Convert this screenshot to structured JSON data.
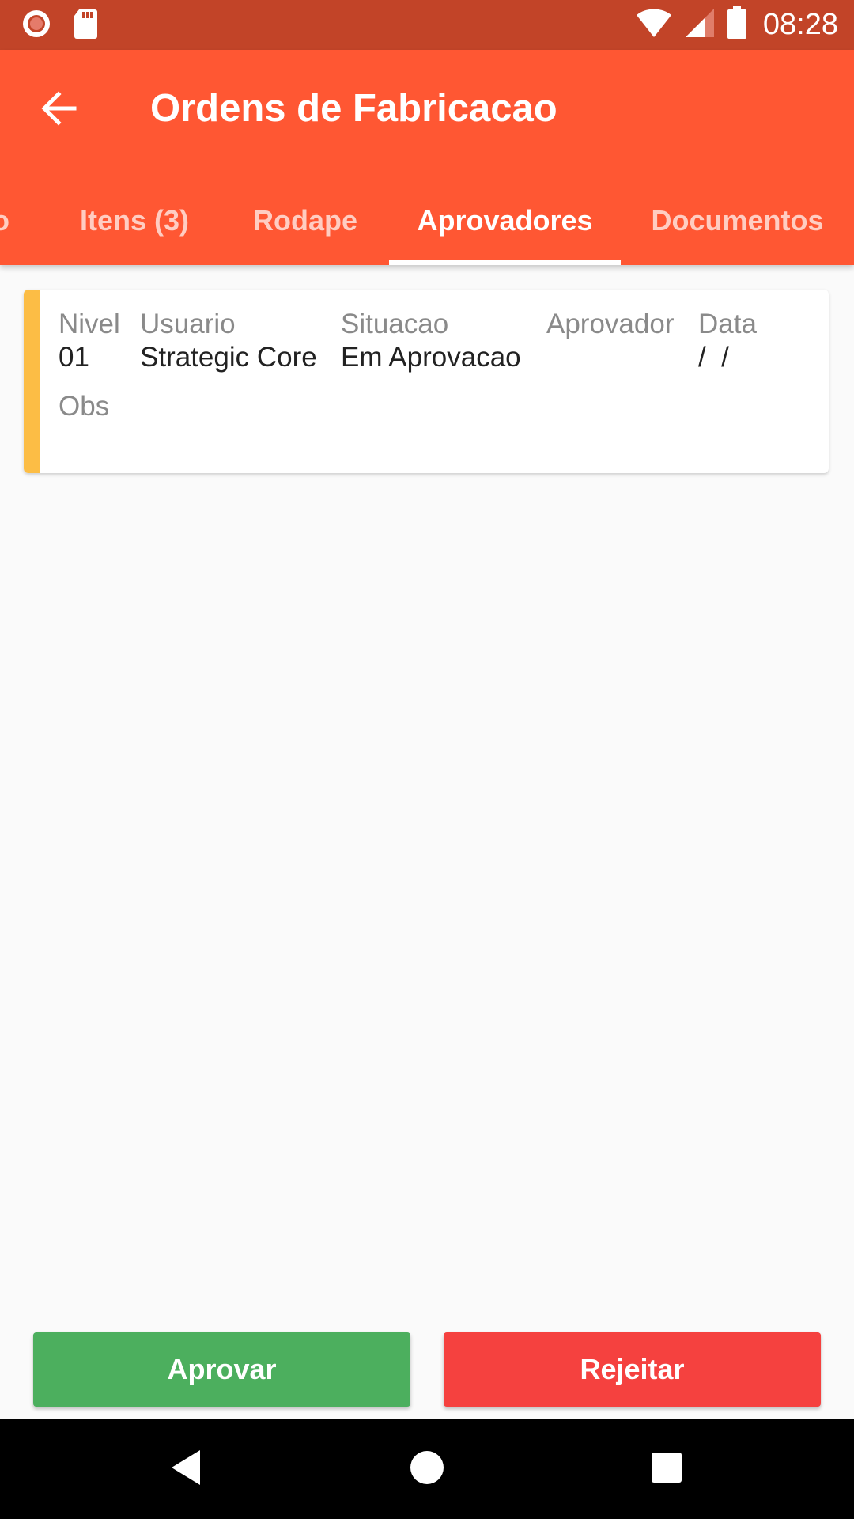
{
  "status_bar": {
    "time": "08:28",
    "icons": [
      "record-icon",
      "sd-card-icon",
      "wifi-icon",
      "signal-icon",
      "battery-icon"
    ]
  },
  "app_bar": {
    "title": "Ordens de Fabricacao",
    "back_icon": "arrow-left-icon"
  },
  "tabs": [
    {
      "label": "o",
      "active": false
    },
    {
      "label": "Itens (3)",
      "active": false
    },
    {
      "label": "Rodape",
      "active": false
    },
    {
      "label": "Aprovadores",
      "active": true
    },
    {
      "label": "Documentos",
      "active": false
    }
  ],
  "approver_card": {
    "nivel_label": "Nivel",
    "nivel_value": "01",
    "usuario_label": "Usuario",
    "usuario_value": "Strategic Core",
    "situacao_label": "Situacao",
    "situacao_value": "Em Aprovacao",
    "aprovador_label": "Aprovador",
    "aprovador_value": "",
    "data_label": "Data",
    "data_value": "/  /",
    "obs_label": "Obs",
    "obs_value": ""
  },
  "actions": {
    "approve_label": "Aprovar",
    "reject_label": "Rejeitar"
  },
  "colors": {
    "status_bar": "#c24428",
    "app_bar": "#ff5733",
    "accent_bar": "#fcbd45",
    "approve": "#4caf5e",
    "reject": "#f5413f"
  },
  "nav_bar": {
    "icons": [
      "back-triangle-icon",
      "home-circle-icon",
      "recents-square-icon"
    ]
  }
}
